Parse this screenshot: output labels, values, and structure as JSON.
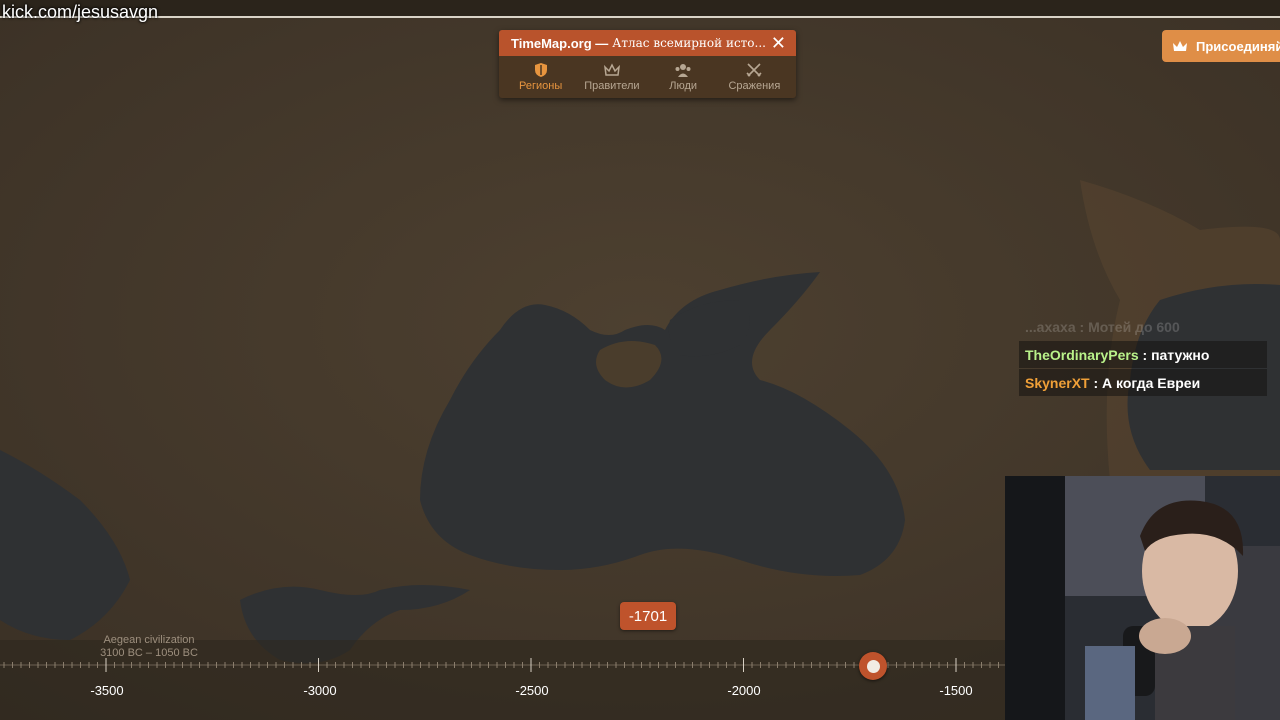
{
  "watermark": "kick.com/jesusavgn",
  "popup": {
    "site": "TimeMap.org —",
    "title": "Атлас всемирной исто...",
    "close_label": "✕",
    "tabs": [
      {
        "label": "Регионы",
        "icon": "shield-icon",
        "active": true
      },
      {
        "label": "Правители",
        "icon": "crown-icon",
        "active": false
      },
      {
        "label": "Люди",
        "icon": "people-icon",
        "active": false
      },
      {
        "label": "Сражения",
        "icon": "crossed-swords-icon",
        "active": false
      }
    ]
  },
  "join_button": {
    "label": "Присоединяй",
    "icon": "crown-icon"
  },
  "chat": [
    {
      "user": "...ахаха",
      "message": "Мотей до 600",
      "user_color": "#ffffff"
    },
    {
      "user": "TheOrdinaryPers",
      "message": "патужно",
      "user_color": "#b9f28a"
    },
    {
      "user": "SkynerXT",
      "message": "А когда Евреи",
      "user_color": "#f0a038"
    }
  ],
  "timeline": {
    "current_year": "-1701",
    "era_label": "Aegean civilization",
    "era_range": "3100 BC – 1050 BC",
    "ticks": [
      "-3500",
      "-3000",
      "-2500",
      "-2000",
      "-1500"
    ]
  },
  "colors": {
    "accent": "#bf532c",
    "join": "#df8e47",
    "land": "#4a3d2c",
    "water": "#2f3133"
  }
}
